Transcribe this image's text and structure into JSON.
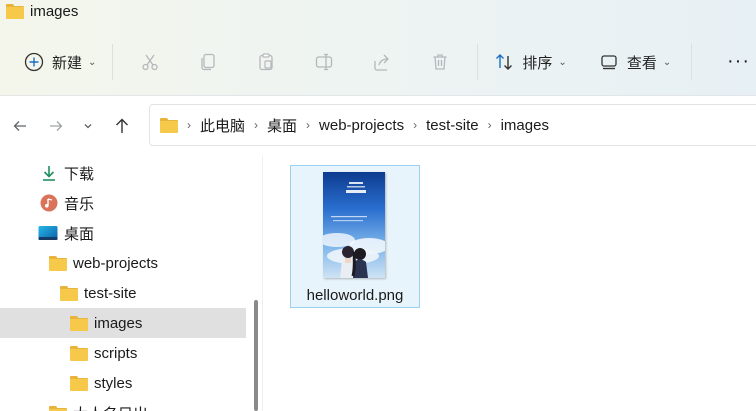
{
  "window": {
    "title": "images"
  },
  "toolbar": {
    "new_label": "新建",
    "sort_label": "排序",
    "view_label": "查看",
    "more_label": "···"
  },
  "address": {
    "crumbs": [
      "此电脑",
      "桌面",
      "web-projects",
      "test-site",
      "images"
    ]
  },
  "sidebar": {
    "items": [
      {
        "label": "下载",
        "icon": "download-icon"
      },
      {
        "label": "音乐",
        "icon": "music-icon"
      },
      {
        "label": "桌面",
        "icon": "desktop-icon"
      },
      {
        "label": "web-projects",
        "icon": "folder-icon"
      },
      {
        "label": "test-site",
        "icon": "folder-icon"
      },
      {
        "label": "images",
        "icon": "folder-icon",
        "selected": true
      },
      {
        "label": "scripts",
        "icon": "folder-icon"
      },
      {
        "label": "styles",
        "icon": "folder-icon"
      },
      {
        "label": "大人名目出",
        "icon": "folder-icon"
      }
    ]
  },
  "files": [
    {
      "name": "helloworld.png",
      "selected": true
    }
  ],
  "colors": {
    "folder": "#f6c94b",
    "selection_border": "#99d1ee",
    "selection_fill": "#e8f4fb",
    "sidebar_selected": "#e0e0e0"
  }
}
